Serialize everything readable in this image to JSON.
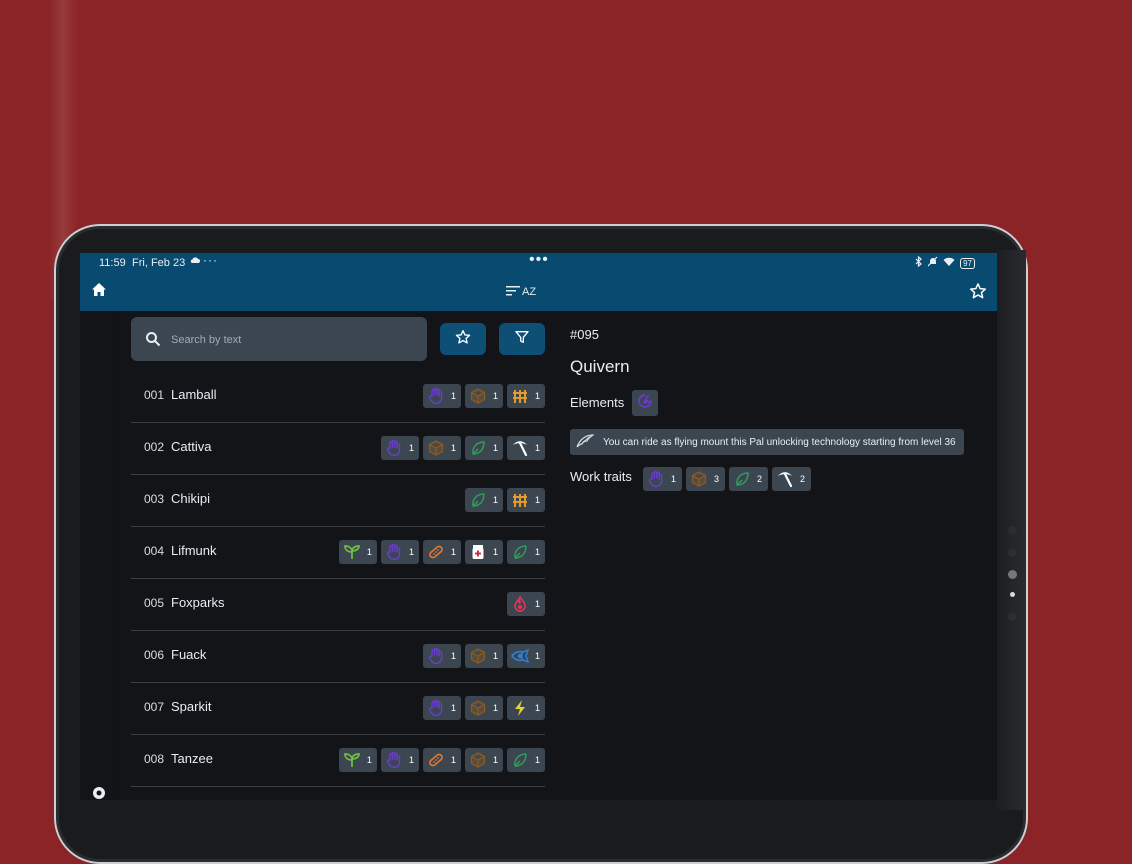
{
  "status_bar": {
    "time": "11:59",
    "date": "Fri, Feb 23",
    "more": "···",
    "center_dots": "•••",
    "battery": "97"
  },
  "app_bar": {
    "sort_label": "AZ"
  },
  "search": {
    "placeholder": "Search by text"
  },
  "colors": {
    "handiwork": "#6a3bd1",
    "transporting": "#8a5a1f",
    "farming": "#e39a2a",
    "gathering": "#2f9e56",
    "mining": "#ffffff",
    "planting": "#74c044",
    "crafting": "#e07a2f",
    "medicine": "#ffffff",
    "kindling": "#e5335a",
    "watering": "#2f7fd8",
    "electricity": "#e8d32a",
    "element_neutral": "#6a3bd1"
  },
  "pals": [
    {
      "num": "001",
      "name": "Lamball",
      "traits": [
        {
          "icon": "handiwork-icon",
          "level": "1"
        },
        {
          "icon": "transporting-icon",
          "level": "1"
        },
        {
          "icon": "farming-icon",
          "level": "1"
        }
      ]
    },
    {
      "num": "002",
      "name": "Cattiva",
      "traits": [
        {
          "icon": "handiwork-icon",
          "level": "1"
        },
        {
          "icon": "transporting-icon",
          "level": "1"
        },
        {
          "icon": "gathering-icon",
          "level": "1"
        },
        {
          "icon": "mining-icon",
          "level": "1"
        }
      ]
    },
    {
      "num": "003",
      "name": "Chikipi",
      "traits": [
        {
          "icon": "gathering-icon",
          "level": "1"
        },
        {
          "icon": "farming-icon",
          "level": "1"
        }
      ]
    },
    {
      "num": "004",
      "name": "Lifmunk",
      "traits": [
        {
          "icon": "planting-icon",
          "level": "1"
        },
        {
          "icon": "handiwork-icon",
          "level": "1"
        },
        {
          "icon": "crafting-icon",
          "level": "1"
        },
        {
          "icon": "medicine-icon",
          "level": "1"
        },
        {
          "icon": "gathering-icon",
          "level": "1"
        }
      ]
    },
    {
      "num": "005",
      "name": "Foxparks",
      "traits": [
        {
          "icon": "kindling-icon",
          "level": "1"
        }
      ]
    },
    {
      "num": "006",
      "name": "Fuack",
      "traits": [
        {
          "icon": "handiwork-icon",
          "level": "1"
        },
        {
          "icon": "transporting-icon",
          "level": "1"
        },
        {
          "icon": "watering-icon",
          "level": "1"
        }
      ]
    },
    {
      "num": "007",
      "name": "Sparkit",
      "traits": [
        {
          "icon": "handiwork-icon",
          "level": "1"
        },
        {
          "icon": "transporting-icon",
          "level": "1"
        },
        {
          "icon": "electricity-icon",
          "level": "1"
        }
      ]
    },
    {
      "num": "008",
      "name": "Tanzee",
      "traits": [
        {
          "icon": "planting-icon",
          "level": "1"
        },
        {
          "icon": "handiwork-icon",
          "level": "1"
        },
        {
          "icon": "crafting-icon",
          "level": "1"
        },
        {
          "icon": "transporting-icon",
          "level": "1"
        },
        {
          "icon": "gathering-icon",
          "level": "1"
        }
      ]
    }
  ],
  "detail": {
    "id": "#095",
    "name": "Quivern",
    "elements_label": "Elements",
    "element_icon": "dragon-element-icon",
    "mount_text": "You can ride as flying mount this Pal unlocking technology starting from level 36",
    "mount_icon": "wing-icon",
    "work_label": "Work traits",
    "work_traits": [
      {
        "icon": "handiwork-icon",
        "level": "1"
      },
      {
        "icon": "transporting-icon",
        "level": "3"
      },
      {
        "icon": "gathering-icon",
        "level": "2"
      },
      {
        "icon": "mining-icon",
        "level": "2"
      }
    ]
  }
}
